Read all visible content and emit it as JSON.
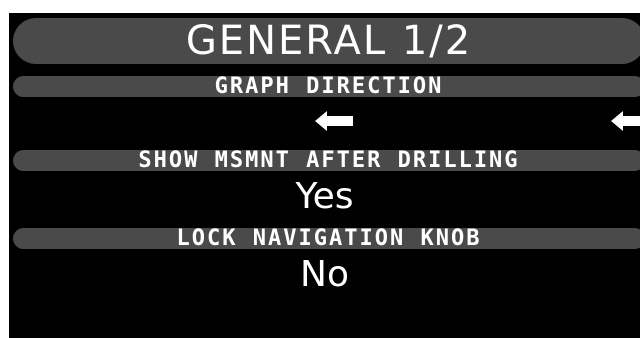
{
  "screen": {
    "title": "GENERAL 1/2",
    "settings": [
      {
        "header": "GRAPH DIRECTION",
        "value_icon": "left-arrow-icon"
      },
      {
        "header": "SHOW MSMNT AFTER DRILLING",
        "value": "Yes"
      },
      {
        "header": "LOCK NAVIGATION KNOB",
        "value": "No"
      }
    ]
  },
  "colors": {
    "background": "#000000",
    "pill": "#4a4a4a",
    "text": "#ffffff"
  }
}
